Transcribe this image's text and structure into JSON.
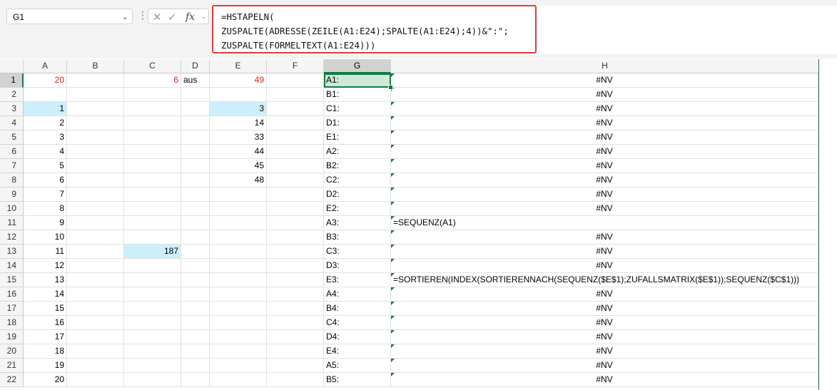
{
  "name_box": "G1",
  "formula_bar": {
    "lines": [
      "=HSTAPELN(",
      "ZUSPALTE(ADRESSE(ZEILE(A1:E24);SPALTE(A1:E24);4))&\":\";",
      "ZUSPALTE(FORMELTEXT(A1:E24)))"
    ],
    "icons": [
      "cancel-icon",
      "enter-icon",
      "fx-icon",
      "chevron-down-icon"
    ]
  },
  "selected_cell": "G1",
  "columns": [
    "A",
    "B",
    "C",
    "D",
    "E",
    "F",
    "G",
    "H"
  ],
  "rows": [
    1,
    2,
    3,
    4,
    5,
    6,
    7,
    8,
    9,
    10,
    11,
    12,
    13,
    14,
    15,
    16,
    17,
    18,
    19,
    20,
    21,
    22
  ],
  "cells": {
    "A1": "20",
    "C1": "6",
    "D1": "aus",
    "E1": "49",
    "A3": "1",
    "A4": "2",
    "A5": "3",
    "A6": "4",
    "A7": "5",
    "A8": "6",
    "A9": "7",
    "A10": "8",
    "A11": "9",
    "A12": "10",
    "A13": "11",
    "A14": "12",
    "A15": "13",
    "A16": "14",
    "A17": "15",
    "A18": "16",
    "A19": "17",
    "A20": "18",
    "A21": "19",
    "A22": "20",
    "E3": "3",
    "E4": "14",
    "E5": "33",
    "E6": "44",
    "E7": "45",
    "E8": "48",
    "C13": "187",
    "G1": "A1:",
    "G2": "B1:",
    "G3": "C1:",
    "G4": "D1:",
    "G5": "E1:",
    "G6": "A2:",
    "G7": "B2:",
    "G8": "C2:",
    "G9": "D2:",
    "G10": "E2:",
    "G11": "A3:",
    "G12": "B3:",
    "G13": "C3:",
    "G14": "D3:",
    "G15": "E3:",
    "G16": "A4:",
    "G17": "B4:",
    "G18": "C4:",
    "G19": "D4:",
    "G20": "E4:",
    "G21": "A5:",
    "G22": "B5:",
    "H1": "#NV",
    "H2": "#NV",
    "H3": "#NV",
    "H4": "#NV",
    "H5": "#NV",
    "H6": "#NV",
    "H7": "#NV",
    "H8": "#NV",
    "H9": "#NV",
    "H10": "#NV",
    "H11": "=SEQUENZ(A1)",
    "H12": "#NV",
    "H13": "#NV",
    "H14": "#NV",
    "H15": "=SORTIEREN(INDEX(SORTIERENNACH(SEQUENZ($E$1);ZUFALLSMATRIX($E$1));SEQUENZ($C$1)))",
    "H16": "#NV",
    "H17": "#NV",
    "H18": "#NV",
    "H19": "#NV",
    "H20": "#NV",
    "H21": "#NV",
    "H22": "#NV"
  },
  "styles": {
    "red_text_cells": [
      "A1",
      "C1",
      "E1"
    ],
    "highlighted_cells": [
      "A3",
      "E3",
      "C13"
    ],
    "text_color_red": "#e0201b",
    "highlight_color": "#cdeffc",
    "accent_green": "#107c41",
    "callout_border": "#e23b3b"
  }
}
